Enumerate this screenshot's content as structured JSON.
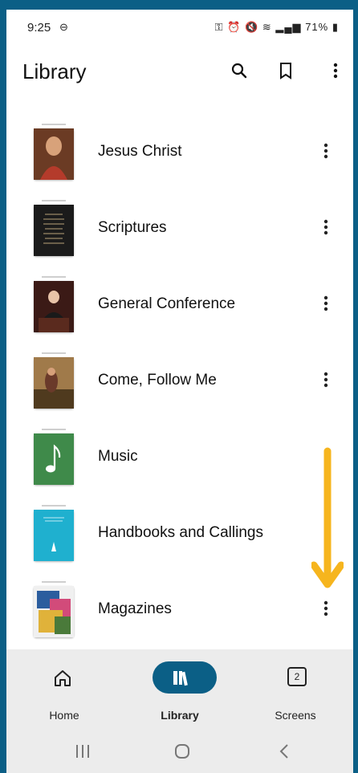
{
  "status_bar": {
    "time": "9:25",
    "battery_percent": "71%"
  },
  "app_bar": {
    "title": "Library"
  },
  "library_items": [
    {
      "label": "Jesus Christ",
      "thumb_color": "#7a4a2c"
    },
    {
      "label": "Scriptures",
      "thumb_color": "#1e1e1e"
    },
    {
      "label": "General Conference",
      "thumb_color": "#4a1e1e"
    },
    {
      "label": "Come, Follow Me",
      "thumb_color": "#8a6a42"
    },
    {
      "label": "Music",
      "thumb_color": "#3f8a4a"
    },
    {
      "label": "Handbooks and Callings",
      "thumb_color": "#20b1d1"
    },
    {
      "label": "Magazines",
      "thumb_color": "#e6e6e6"
    }
  ],
  "bottom_nav": {
    "home_label": "Home",
    "library_label": "Library",
    "screens_label": "Screens",
    "screens_count": "2"
  },
  "accent_color": "#0b5f86",
  "arrow_color": "#f6b51e"
}
